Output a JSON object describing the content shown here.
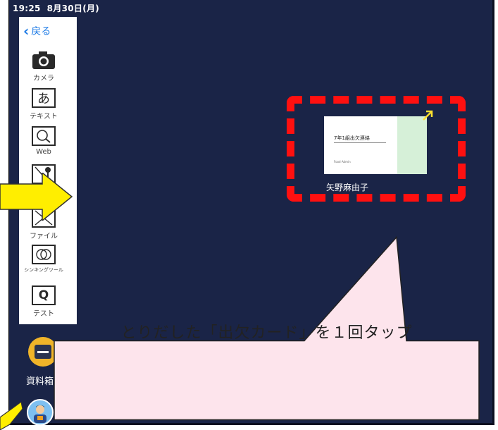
{
  "status": {
    "time": "19:25",
    "date": "8月30日(月)"
  },
  "sidebar": {
    "back_label": "戻る",
    "tools": [
      {
        "label": "カメラ",
        "icon": "camera-icon"
      },
      {
        "label": "テキスト",
        "icon": "text-a-icon",
        "glyph": "あ"
      },
      {
        "label": "Web",
        "icon": "web-search-icon"
      },
      {
        "label": "",
        "icon": "image-pin-icon"
      },
      {
        "label": "ファイル",
        "icon": "file-icon"
      },
      {
        "label": "シンキングツール",
        "icon": "thinking-tool-icon"
      },
      {
        "label": "テスト",
        "icon": "test-icon",
        "glyph": "Q"
      }
    ]
  },
  "bottom": {
    "documents_label": "資料箱"
  },
  "card": {
    "title": "7年1組出欠連絡",
    "small_text": "Food Admin",
    "owner": "矢野麻由子"
  },
  "callout": {
    "text": "とりだした「出欠カード」を１回タップ"
  },
  "colors": {
    "background": "#1a2447",
    "highlight": "#ff1010",
    "callout_fill": "#fde4ec",
    "pointer_arrow": "#ffee00"
  }
}
